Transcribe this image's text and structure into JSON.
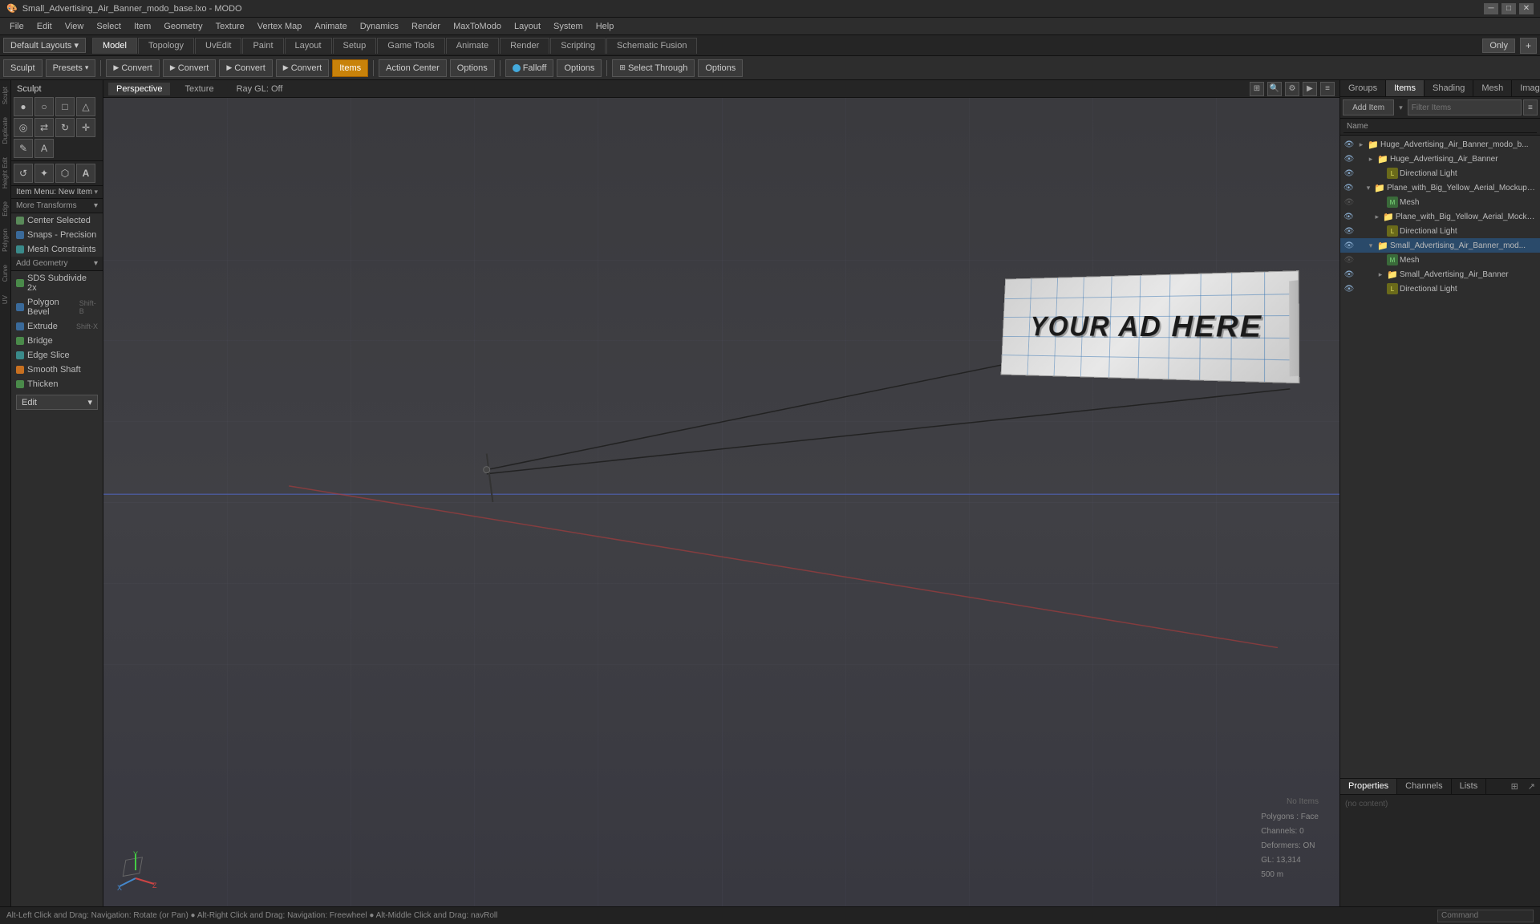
{
  "titlebar": {
    "title": "Small_Advertising_Air_Banner_modo_base.lxo - MODO",
    "controls": [
      "─",
      "□",
      "✕"
    ]
  },
  "menubar": {
    "items": [
      "File",
      "Edit",
      "View",
      "Select",
      "Item",
      "Geometry",
      "Texture",
      "Vertex Map",
      "Animate",
      "Dynamics",
      "Render",
      "MaxToModo",
      "Layout",
      "System",
      "Help"
    ]
  },
  "layout_bar": {
    "default_layouts": "Default Layouts ▾",
    "tabs": [
      "Model",
      "Topology",
      "UvEdit",
      "Paint",
      "Layout",
      "Setup",
      "Game Tools",
      "Animate",
      "Render",
      "Scripting",
      "Schematic Fusion"
    ],
    "active_tab": "Model",
    "only_btn": "Only",
    "plus_btn": "+"
  },
  "toolbar": {
    "sculpt_label": "Sculpt",
    "presets_label": "Presets",
    "convert_btns": [
      "Convert",
      "Convert",
      "Convert",
      "Convert"
    ],
    "items_label": "Items",
    "action_center_label": "Action Center",
    "options1_label": "Options",
    "falloff_label": "Falloff",
    "options2_label": "Options",
    "select_through_label": "Select Through",
    "options3_label": "Options"
  },
  "left_panel": {
    "transforms_label": "More Transforms",
    "center_selected_label": "Center Selected",
    "snaps_label": "Snaps - Precision",
    "mesh_constraints_label": "Mesh Constraints",
    "add_geometry_label": "Add Geometry",
    "tools": [
      {
        "label": "SDS Subdivide 2x",
        "icon": "green",
        "shortcut": ""
      },
      {
        "label": "Polygon Bevel",
        "icon": "blue",
        "shortcut": "Shift-B"
      },
      {
        "label": "Extrude",
        "icon": "blue",
        "shortcut": "Shift-X"
      },
      {
        "label": "Bridge",
        "icon": "green",
        "shortcut": ""
      },
      {
        "label": "Edge Slice",
        "icon": "teal",
        "shortcut": ""
      },
      {
        "label": "Smooth Shaft",
        "icon": "orange",
        "shortcut": ""
      },
      {
        "label": "Thicken",
        "icon": "green",
        "shortcut": ""
      }
    ],
    "edit_label": "Edit"
  },
  "viewport": {
    "mode_tabs": [
      "Perspective",
      "Texture",
      "Ray GL: Off"
    ],
    "icons": [
      "⊞",
      "🔍",
      "⚙",
      "▶",
      "≡"
    ]
  },
  "right_panel": {
    "tabs": [
      "Groups",
      "Items",
      "Shading",
      "Mesh",
      "Images"
    ],
    "add_item_label": "Add Item",
    "filter_placeholder": "Filter Items",
    "name_col": "Name",
    "tree_items": [
      {
        "id": 1,
        "indent": 0,
        "arrow": "▸",
        "type": "folder",
        "label": "Huge_Advertising_Air_Banner_modo_b...",
        "eye": true,
        "visible": true
      },
      {
        "id": 2,
        "indent": 1,
        "arrow": "▸",
        "type": "folder",
        "label": "Huge_Advertising_Air_Banner",
        "eye": true,
        "visible": true
      },
      {
        "id": 3,
        "indent": 2,
        "arrow": "",
        "type": "light",
        "label": "Directional Light",
        "eye": true,
        "visible": true
      },
      {
        "id": 4,
        "indent": 1,
        "arrow": "▾",
        "type": "folder",
        "label": "Plane_with_Big_Yellow_Aerial_Mockup_Ban...",
        "eye": true,
        "visible": true
      },
      {
        "id": 5,
        "indent": 2,
        "arrow": "",
        "type": "mesh",
        "label": "Mesh",
        "eye": true,
        "visible": false
      },
      {
        "id": 6,
        "indent": 2,
        "arrow": "▸",
        "type": "folder",
        "label": "Plane_with_Big_Yellow_Aerial_Mockup_B...",
        "eye": true,
        "visible": true
      },
      {
        "id": 7,
        "indent": 2,
        "arrow": "",
        "type": "light",
        "label": "Directional Light",
        "eye": true,
        "visible": true
      },
      {
        "id": 8,
        "indent": 1,
        "arrow": "▾",
        "type": "folder",
        "label": "Small_Advertising_Air_Banner_mod...",
        "eye": true,
        "visible": true,
        "selected": true
      },
      {
        "id": 9,
        "indent": 2,
        "arrow": "",
        "type": "mesh",
        "label": "Mesh",
        "eye": true,
        "visible": false
      },
      {
        "id": 10,
        "indent": 2,
        "arrow": "▸",
        "type": "folder",
        "label": "Small_Advertising_Air_Banner",
        "eye": true,
        "visible": true
      },
      {
        "id": 11,
        "indent": 2,
        "arrow": "",
        "type": "light",
        "label": "Directional Light",
        "eye": true,
        "visible": true
      }
    ],
    "bottom_tabs": [
      "Properties",
      "Channels",
      "Lists"
    ],
    "viewport_info": {
      "no_items": "No Items",
      "polygons": "Polygons : Face",
      "channels": "Channels: 0",
      "deformers": "Deformers: ON",
      "gl": "GL: 13,314",
      "size": "500 m"
    }
  },
  "statusbar": {
    "text": "Alt-Left Click and Drag: Navigation: Rotate (or Pan) ● Alt-Right Click and Drag: Navigation: Freewheel ● Alt-Middle Click and Drag: navRoll",
    "command_placeholder": "Command"
  },
  "banner": {
    "text": "YOUR AD HERE"
  },
  "vtabs": [
    "Sculpt",
    "Duplicate",
    "Height Edit",
    "Edge",
    "Polygon",
    "Curve",
    "UV"
  ]
}
